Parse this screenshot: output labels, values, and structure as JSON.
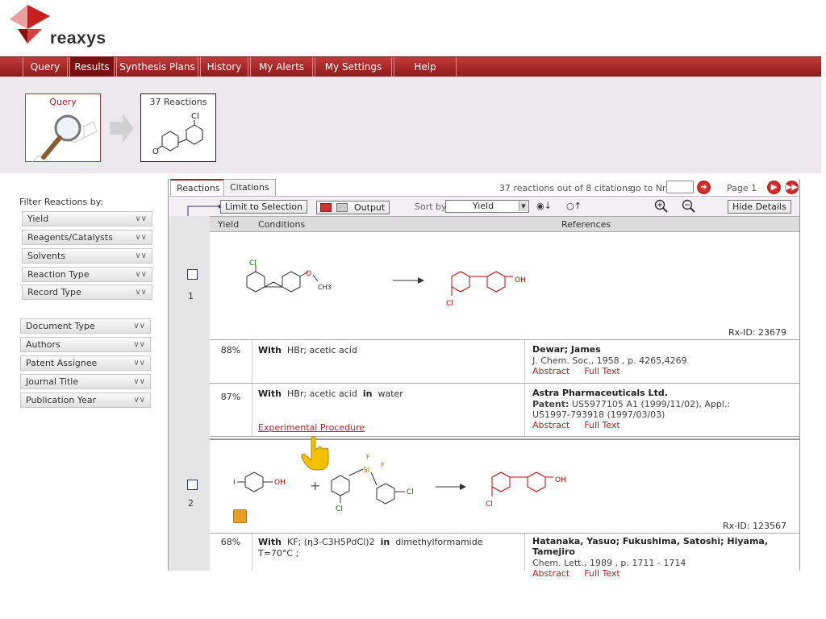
{
  "brand": {
    "name": "reaxys",
    "accent": "#a31a1a"
  },
  "nav": [
    {
      "label": "Query"
    },
    {
      "label": "Results"
    },
    {
      "label": "Synthesis Plans"
    },
    {
      "label": "History"
    },
    {
      "label": "My Alerts"
    },
    {
      "label": "My Settings"
    },
    {
      "label": "Help"
    }
  ],
  "breadcrumb": {
    "query_label": "Query",
    "results_label": "37 Reactions"
  },
  "sidebar": {
    "title": "Filter Reactions by:",
    "reaction_filters": [
      "Yield",
      "Reagents/Catalysts",
      "Solvents",
      "Reaction Type",
      "Record Type"
    ],
    "citation_filters": [
      "Document Type",
      "Authors",
      "Patent Assignee",
      "Journal Title",
      "Publication Year"
    ]
  },
  "results": {
    "tabs": [
      "Reactions",
      "Citations"
    ],
    "summary": "37 reactions out of 8 citations",
    "goto_label": "go to Nr.",
    "page_label": "Page 1",
    "toolbar": {
      "limit_label": "Limit to Selection",
      "output_label": "Output",
      "sortby_label": "Sort by",
      "sort_value": "Yield",
      "hide_details_label": "Hide Details"
    },
    "columns": [
      "Yield",
      "Conditions",
      "References"
    ],
    "reactions": [
      {
        "num": "1",
        "rxid": "Rx-ID: 23679",
        "details": [
          {
            "yield": "88%",
            "with_label": "With",
            "reagents": "HBr; acetic acid",
            "authors": "Dewar; James",
            "citation": "J. Chem. Soc., 1958 , p. 4265,4269",
            "links": [
              "Abstract",
              "Full Text"
            ]
          },
          {
            "yield": "87%",
            "with_label": "With",
            "reagents": "HBr; acetic acid",
            "in_label": "in",
            "solvent": "water",
            "procedure": "Experimental Procedure",
            "authors": "Astra Pharmaceuticals Ltd.",
            "patent_label": "Patent:",
            "citation": "US5977105 A1 (1999/11/02), Appl.: US1997-793918 (1997/03/03)",
            "links": [
              "Abstract",
              "Full Text"
            ]
          }
        ]
      },
      {
        "num": "2",
        "rxid": "Rx-ID: 123567",
        "details": [
          {
            "yield": "68%",
            "with_label": "With",
            "reagents": "KF; (η3-C3H5PdCl)2",
            "in_label": "in",
            "solvent": "dimethylformamide",
            "temp": "T=70°C ;",
            "authors": "Hatanaka, Yasuo; Fukushima, Satoshi; Hiyama, Tamejiro",
            "citation": "Chem. Lett., 1989 , p. 1711 - 1714",
            "links": [
              "Abstract",
              "Full Text"
            ]
          }
        ]
      }
    ]
  }
}
